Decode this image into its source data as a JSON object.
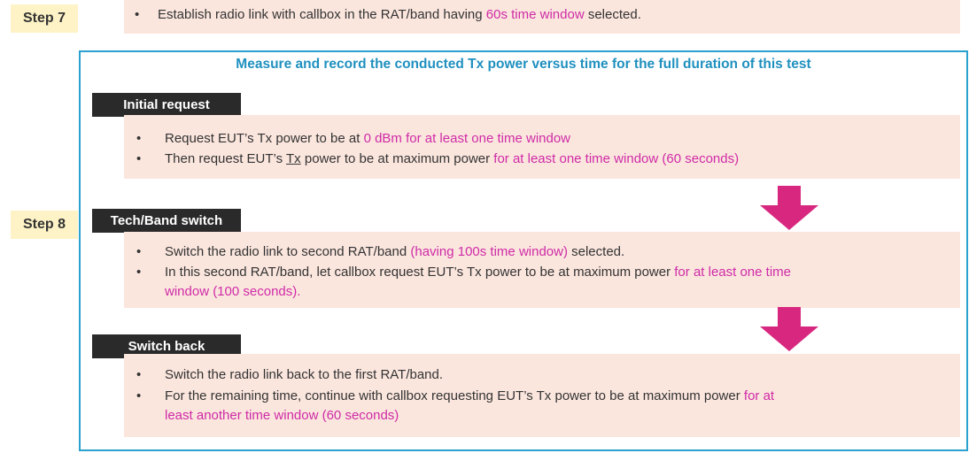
{
  "colors": {
    "highlight": "#cf2ba6",
    "frame": "#2aa1cf",
    "step_bg": "#fdf3c6",
    "box_bg": "#fbe6de",
    "arrow": "#d8277f"
  },
  "step7": {
    "label": "Step 7",
    "line": {
      "a": "Establish radio link with callbox in the RAT/band having ",
      "b": "60s time window",
      "c": " selected."
    }
  },
  "step8": {
    "label": "Step 8"
  },
  "heading": "Measure and record the conducted Tx power versus time for the full duration of this test",
  "sections": {
    "initial": {
      "title": "Initial request",
      "b1": {
        "a": "Request EUT’s Tx power to be at ",
        "b": "0 dBm for at least one time window"
      },
      "b2": {
        "a": "Then request EUT’s ",
        "u": "Tx",
        "c": " power to be at maximum power ",
        "d": "for at least one time window (60 seconds)"
      }
    },
    "switch": {
      "title": "Tech/Band switch",
      "b1": {
        "a": "Switch the radio link to second RAT/band ",
        "b": "(having 100s time window)",
        "c": " selected."
      },
      "b2": {
        "a": "In this second RAT/band, let callbox request EUT’s Tx power to be at maximum power ",
        "b": "for at least one time",
        "c": "window (100 seconds)."
      }
    },
    "back": {
      "title": "Switch back",
      "b1": {
        "a": "Switch the radio link back to the first RAT/band."
      },
      "b2": {
        "a": "For the remaining time, continue with callbox requesting EUT’s Tx power to be at maximum power ",
        "b": "for at",
        "c": "least another time window (60 seconds)"
      }
    }
  },
  "bullet_char": "•",
  "icons": {
    "arrow1": "arrow-down-icon",
    "arrow2": "arrow-down-icon"
  }
}
